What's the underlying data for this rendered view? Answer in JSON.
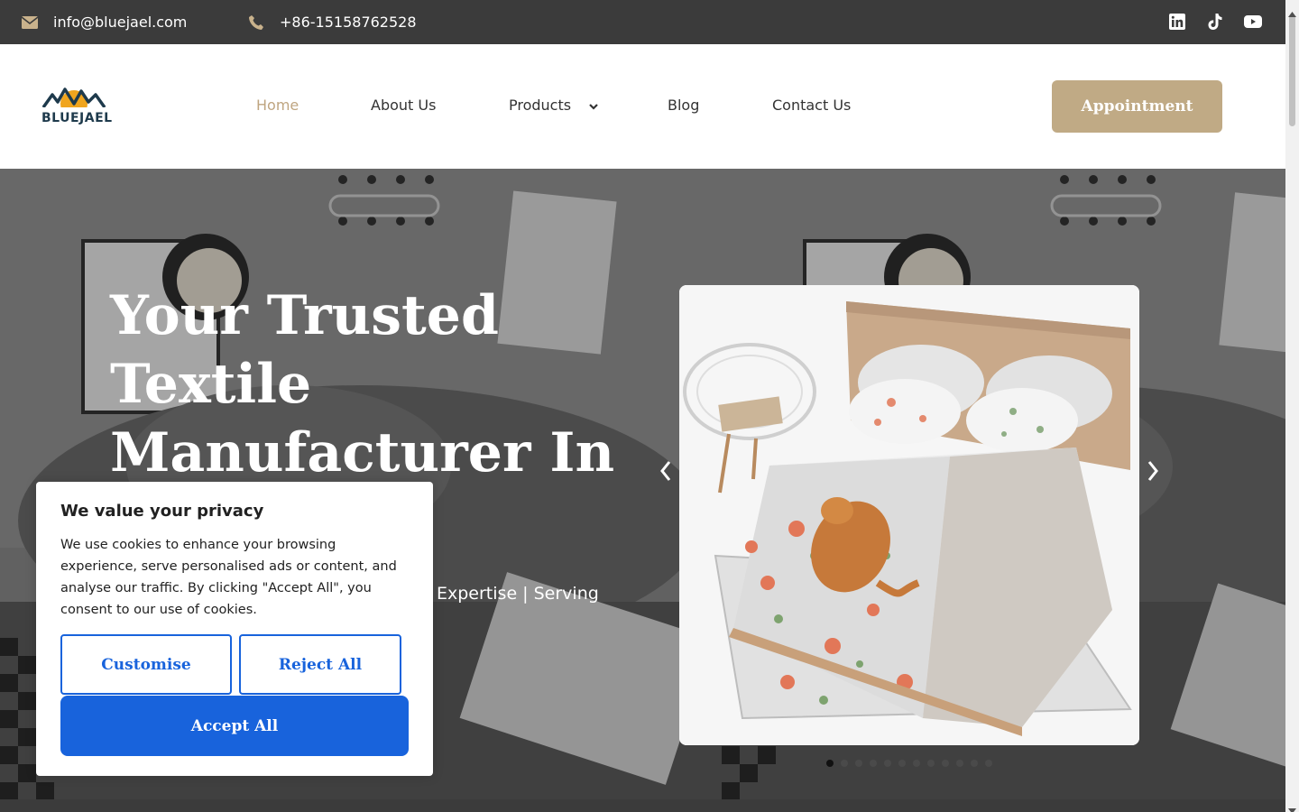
{
  "topbar": {
    "email": "info@bluejael.com",
    "phone": "+86-15158762528",
    "social_icons": [
      "linkedin-icon",
      "tiktok-icon",
      "youtube-icon"
    ]
  },
  "header": {
    "logo_text": "BLUEJAEL",
    "nav": [
      {
        "label": "Home",
        "active": true
      },
      {
        "label": "About Us",
        "active": false
      },
      {
        "label": "Products",
        "active": false,
        "has_dropdown": true
      },
      {
        "label": "Blog",
        "active": false
      },
      {
        "label": "Contact Us",
        "active": false
      }
    ],
    "cta_label": "Appointment"
  },
  "hero": {
    "title_line1": "Your Trusted",
    "title_line2": "Textile",
    "title_line3": "Manufacturer In",
    "subtitle_visible": "Expertise | Serving",
    "slides_count": 12,
    "active_slide": 1
  },
  "cookie_banner": {
    "title": "We value your privacy",
    "body": "We use cookies to enhance your browsing experience, serve personalised ads or content, and analyse our traffic. By clicking \"Accept All\", you consent to our use of cookies.",
    "customise_label": "Customise",
    "reject_label": "Reject All",
    "accept_label": "Accept All"
  },
  "colors": {
    "topbar_bg": "#3b3b3b",
    "accent_gold": "#c0aa85",
    "active_nav": "#bfa580",
    "cookie_blue": "#1863dc"
  }
}
